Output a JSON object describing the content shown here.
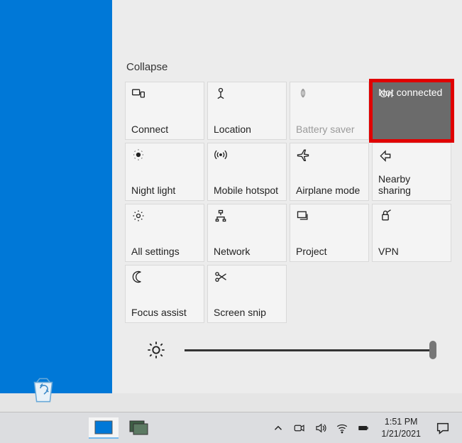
{
  "collapse_label": "Collapse",
  "tiles": [
    {
      "label": "Connect"
    },
    {
      "label": "Location"
    },
    {
      "label": "Battery saver"
    },
    {
      "top": "On",
      "label": "Not connected"
    },
    {
      "label": "Night light"
    },
    {
      "label": "Mobile hotspot"
    },
    {
      "label": "Airplane mode"
    },
    {
      "label": "Nearby sharing"
    },
    {
      "label": "All settings"
    },
    {
      "label": "Network"
    },
    {
      "label": "Project"
    },
    {
      "label": "VPN"
    },
    {
      "label": "Focus assist"
    },
    {
      "label": "Screen snip"
    }
  ],
  "brightness_value": 98,
  "taskbar": {
    "time": "1:51 PM",
    "date": "1/21/2021"
  }
}
